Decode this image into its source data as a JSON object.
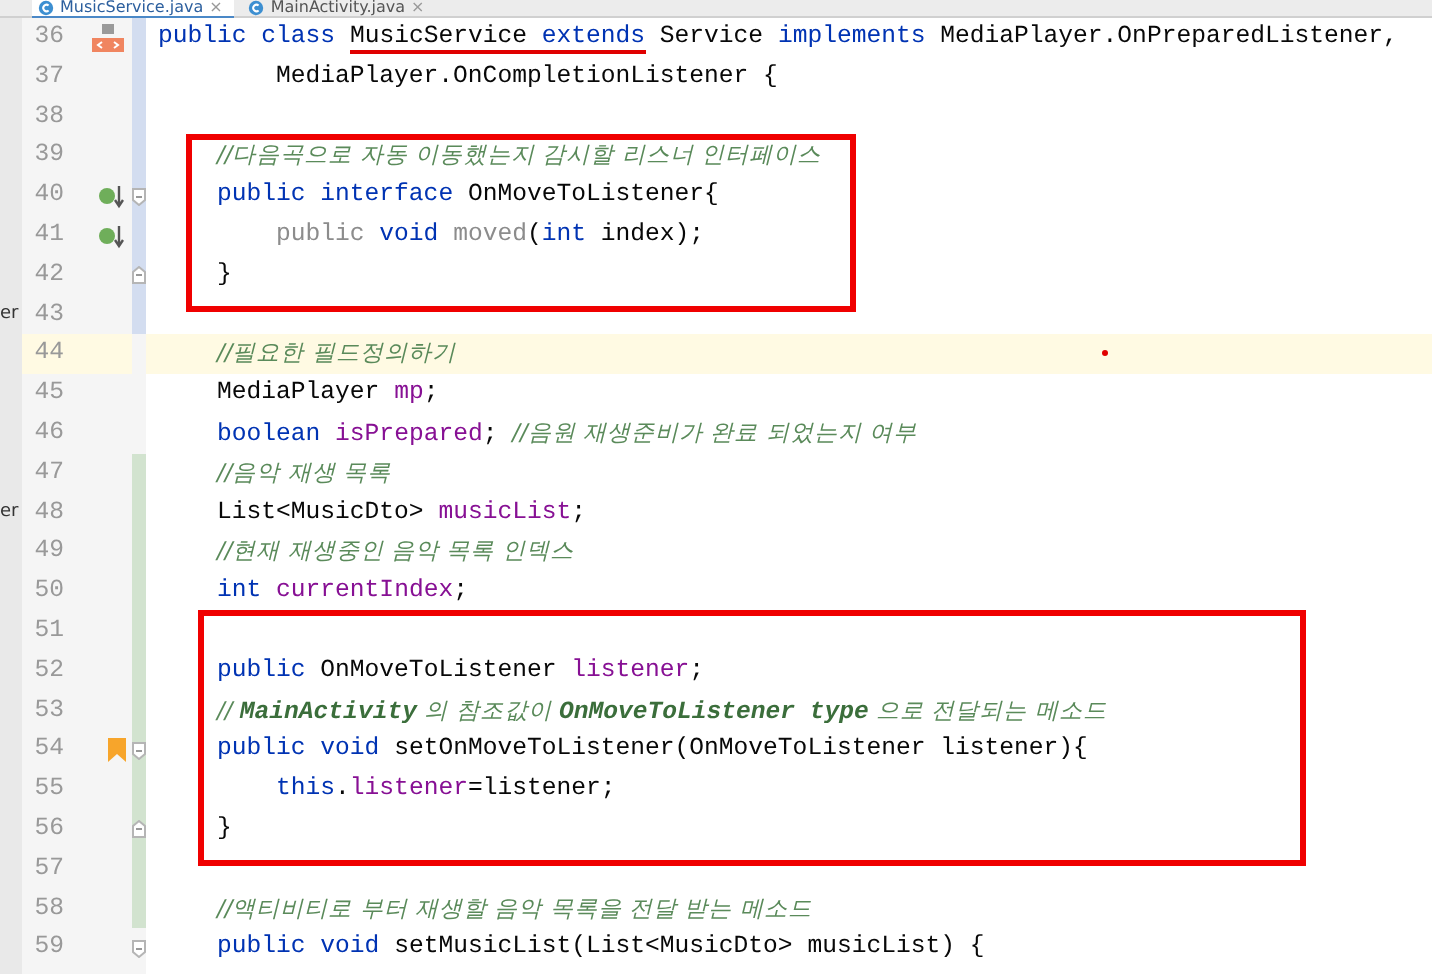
{
  "tabs": [
    {
      "label": "MusicService.java",
      "close": "×",
      "selected": true
    },
    {
      "label": "MainActivity.java",
      "close": "×",
      "selected": false
    }
  ],
  "lines": [
    {
      "number": "36",
      "kind": "declaration",
      "gutter": {
        "kind": "class"
      },
      "change_bar": {
        "color": "#d3ddf0"
      },
      "current": false,
      "in_red_box": false,
      "red_dot": false,
      "segments": [
        {
          "text": "public class ",
          "kind": "keyword"
        },
        {
          "text": "MusicService ",
          "kind": "plain",
          "underlined": true
        },
        {
          "text": "extends",
          "kind": "keyword",
          "underlined": true
        },
        {
          "text": " Service ",
          "kind": "plain"
        },
        {
          "text": "implements",
          "kind": "keyword"
        },
        {
          "text": " MediaPlayer.OnPreparedListener,",
          "kind": "plain"
        }
      ]
    },
    {
      "number": "37",
      "kind": "continuation",
      "change_bar": {
        "color": "#d3ddf0"
      },
      "current": false,
      "in_red_box": false,
      "red_dot": false,
      "segments": [
        {
          "text": "MediaPlayer.OnCompletionListener {",
          "kind": "plain"
        }
      ]
    },
    {
      "number": "38",
      "kind": "member",
      "change_bar": {
        "color": "#d3ddf0"
      },
      "current": false,
      "in_red_box": false,
      "red_dot": false
    },
    {
      "number": "39",
      "kind": "member",
      "change_bar": {
        "color": "#d3ddf0"
      },
      "current": false,
      "in_red_box": true,
      "red_dot": false,
      "segments": [
        {
          "text": "//다음곡으로 자동 이동했는지 감시할 리스너 인터페이스",
          "kind": "comment"
        }
      ]
    },
    {
      "number": "40",
      "kind": "member",
      "gutter": {
        "kind": "implemented"
      },
      "fold": {
        "kind": "start"
      },
      "change_bar": {
        "color": "#d3ddf0"
      },
      "current": false,
      "in_red_box": true,
      "red_dot": false,
      "segments": [
        {
          "text": "public interface",
          "kind": "keyword"
        },
        {
          "text": " OnMoveToListener{",
          "kind": "plain"
        }
      ]
    },
    {
      "number": "41",
      "kind": "statement",
      "gutter": {
        "kind": "implemented"
      },
      "change_bar": {
        "color": "#d3ddf0"
      },
      "current": false,
      "in_red_box": true,
      "red_dot": false,
      "segments": [
        {
          "text": "public ",
          "kind": "unused"
        },
        {
          "text": "void ",
          "kind": "keyword"
        },
        {
          "text": "moved",
          "kind": "unused"
        },
        {
          "text": "(",
          "kind": "plain"
        },
        {
          "text": "int",
          "kind": "keyword"
        },
        {
          "text": " index);",
          "kind": "plain"
        }
      ]
    },
    {
      "number": "42",
      "kind": "member",
      "fold": {
        "kind": "end"
      },
      "change_bar": {
        "color": "#d3ddf0"
      },
      "current": false,
      "in_red_box": true,
      "red_dot": false,
      "segments": [
        {
          "text": "}",
          "kind": "plain"
        }
      ]
    },
    {
      "number": "43",
      "kind": "member",
      "left_fragment": "er",
      "change_bar": {
        "color": "#d3ddf0"
      },
      "current": false,
      "in_red_box": false,
      "red_dot": false
    },
    {
      "number": "44",
      "kind": "member",
      "current": true,
      "in_red_box": false,
      "red_dot": true,
      "segments": [
        {
          "text": "//필요한 필드정의하기",
          "kind": "comment"
        }
      ]
    },
    {
      "number": "45",
      "kind": "member",
      "current": false,
      "in_red_box": false,
      "red_dot": false,
      "segments": [
        {
          "text": "MediaPlayer ",
          "kind": "plain"
        },
        {
          "text": "mp",
          "kind": "field"
        },
        {
          "text": ";",
          "kind": "plain"
        }
      ]
    },
    {
      "number": "46",
      "kind": "member",
      "current": false,
      "in_red_box": false,
      "red_dot": false,
      "segments": [
        {
          "text": "boolean ",
          "kind": "keyword"
        },
        {
          "text": "isPrepared",
          "kind": "field"
        },
        {
          "text": "; ",
          "kind": "plain"
        },
        {
          "text": "//음원 재생준비가 완료 되었는지 여부",
          "kind": "comment"
        }
      ]
    },
    {
      "number": "47",
      "kind": "member",
      "change_bar": {
        "color": "#d2e3cf"
      },
      "current": false,
      "in_red_box": false,
      "red_dot": false,
      "segments": [
        {
          "text": "//음악 재생 목록",
          "kind": "comment"
        }
      ]
    },
    {
      "number": "48",
      "kind": "member",
      "left_fragment": "er",
      "change_bar": {
        "color": "#d2e3cf"
      },
      "current": false,
      "in_red_box": false,
      "red_dot": false,
      "segments": [
        {
          "text": "List<MusicDto> ",
          "kind": "plain"
        },
        {
          "text": "musicList",
          "kind": "field"
        },
        {
          "text": ";",
          "kind": "plain"
        }
      ]
    },
    {
      "number": "49",
      "kind": "member",
      "change_bar": {
        "color": "#d2e3cf"
      },
      "current": false,
      "in_red_box": false,
      "red_dot": false,
      "segments": [
        {
          "text": "//현재 재생중인 음악 목록 인덱스",
          "kind": "comment"
        }
      ]
    },
    {
      "number": "50",
      "kind": "member",
      "change_bar": {
        "color": "#d2e3cf"
      },
      "current": false,
      "in_red_box": false,
      "red_dot": false,
      "segments": [
        {
          "text": "int ",
          "kind": "keyword"
        },
        {
          "text": "currentIndex",
          "kind": "field"
        },
        {
          "text": ";",
          "kind": "plain"
        }
      ]
    },
    {
      "number": "51",
      "kind": "member",
      "change_bar": {
        "color": "#d2e3cf"
      },
      "current": false,
      "in_red_box": true,
      "red_dot": false
    },
    {
      "number": "52",
      "kind": "member",
      "change_bar": {
        "color": "#d2e3cf"
      },
      "current": false,
      "in_red_box": true,
      "red_dot": false,
      "segments": [
        {
          "text": "public",
          "kind": "keyword"
        },
        {
          "text": " OnMoveToListener ",
          "kind": "plain"
        },
        {
          "text": "listener",
          "kind": "field"
        },
        {
          "text": ";",
          "kind": "plain"
        }
      ]
    },
    {
      "number": "53",
      "kind": "member",
      "change_bar": {
        "color": "#d2e3cf"
      },
      "current": false,
      "in_red_box": true,
      "red_dot": false,
      "segments": [
        {
          "text": "// ",
          "kind": "comment"
        },
        {
          "text": "MainActivity",
          "kind": "comment_ref"
        },
        {
          "text": " 의 참조값이 ",
          "kind": "comment"
        },
        {
          "text": "OnMoveToListener type",
          "kind": "comment_ref"
        },
        {
          "text": " 으로 전달되는 메소드",
          "kind": "comment"
        }
      ]
    },
    {
      "number": "54",
      "kind": "member",
      "gutter": {
        "kind": "bookmark"
      },
      "fold": {
        "kind": "start"
      },
      "change_bar": {
        "color": "#d2e3cf"
      },
      "current": false,
      "in_red_box": true,
      "red_dot": false,
      "segments": [
        {
          "text": "public void",
          "kind": "keyword"
        },
        {
          "text": " setOnMoveToListener(OnMoveToListener listener){",
          "kind": "plain"
        }
      ]
    },
    {
      "number": "55",
      "kind": "statement",
      "change_bar": {
        "color": "#d2e3cf"
      },
      "current": false,
      "in_red_box": true,
      "red_dot": false,
      "segments": [
        {
          "text": "this",
          "kind": "keyword"
        },
        {
          "text": ".",
          "kind": "plain"
        },
        {
          "text": "listener",
          "kind": "field"
        },
        {
          "text": "=listener;",
          "kind": "plain"
        }
      ]
    },
    {
      "number": "56",
      "kind": "member",
      "fold": {
        "kind": "end"
      },
      "change_bar": {
        "color": "#d2e3cf"
      },
      "current": false,
      "in_red_box": true,
      "red_dot": false,
      "segments": [
        {
          "text": "}",
          "kind": "plain"
        }
      ]
    },
    {
      "number": "57",
      "kind": "member",
      "change_bar": {
        "color": "#d2e3cf"
      },
      "current": false,
      "in_red_box": false,
      "red_dot": false
    },
    {
      "number": "58",
      "kind": "member",
      "change_bar": {
        "color": "#d2e3cf"
      },
      "current": false,
      "in_red_box": false,
      "red_dot": false,
      "segments": [
        {
          "text": "//액티비티로 부터 재생할 음악 목록을 전달 받는 메소드",
          "kind": "comment"
        }
      ]
    },
    {
      "number": "59",
      "kind": "member",
      "fold": {
        "kind": "start"
      },
      "current": false,
      "in_red_box": false,
      "red_dot": false,
      "segments": [
        {
          "text": "public void",
          "kind": "keyword"
        },
        {
          "text": " setMusicList(List<MusicDto> musicList) {",
          "kind": "plain"
        }
      ]
    }
  ]
}
